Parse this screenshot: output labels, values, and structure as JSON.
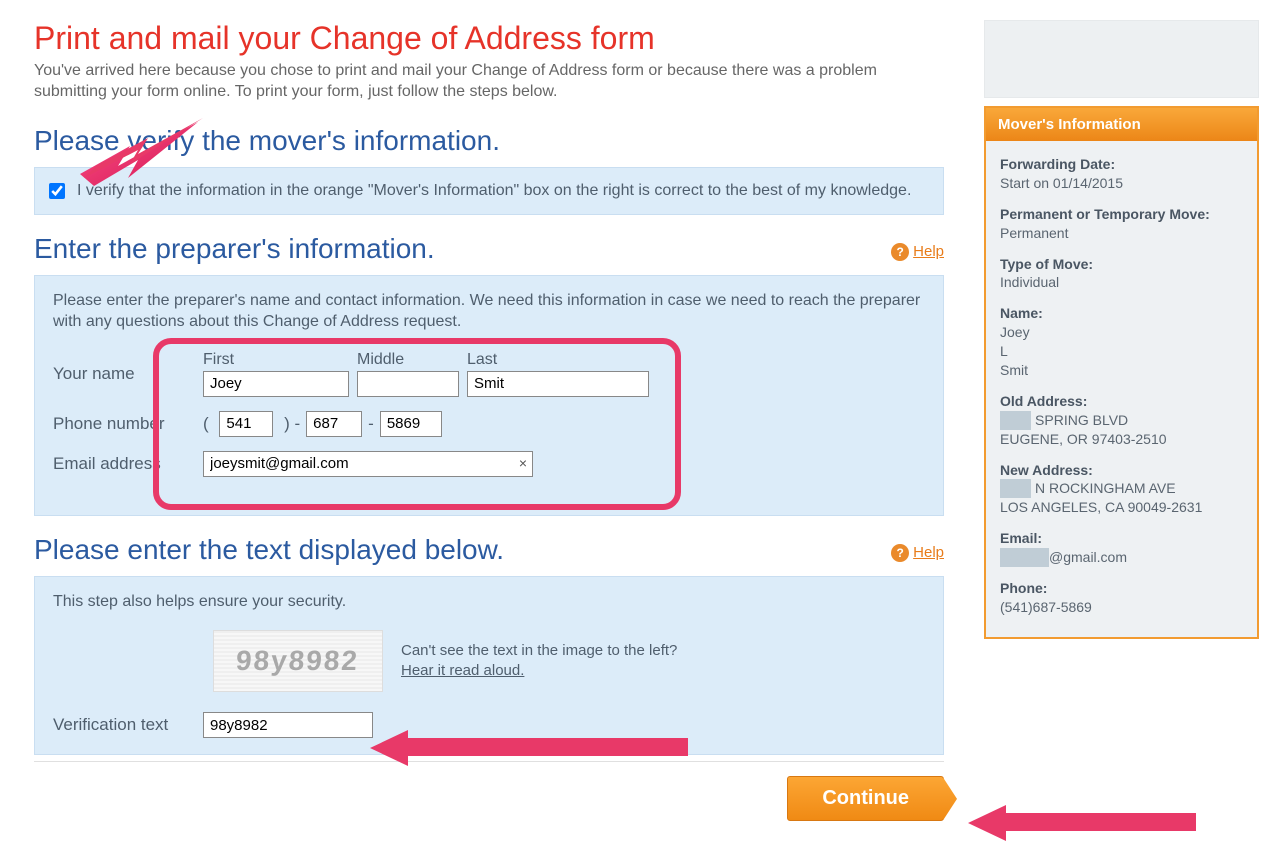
{
  "title": "Print and mail your Change of Address form",
  "intro": "You've arrived here because you chose to print and mail your Change of Address form or because there was a problem submitting your form online. To print your form, just follow the steps below.",
  "verify_heading": "Please verify the mover's information.",
  "verify_label": "I verify that the information in the orange \"Mover's Information\" box on the right is correct to the best of my knowledge.",
  "preparer_heading": "Enter the preparer's information.",
  "help_label": "Help",
  "preparer_note": "Please enter the preparer's name and contact information. We need this information in case we need to reach the preparer with any questions about this Change of Address request.",
  "name_label": "Your name",
  "first_hdr": "First",
  "middle_hdr": "Middle",
  "last_hdr": "Last",
  "first_val": "Joey",
  "middle_val": "",
  "last_val": "Smit",
  "phone_label": "Phone number",
  "phone_a": "541",
  "phone_b": "687",
  "phone_c": "5869",
  "email_label": "Email address",
  "email_val": "joeysmit@gmail.com",
  "captcha_heading": "Please enter the text displayed below.",
  "captcha_note": "This step also helps ensure your security.",
  "captcha_value_img": "98y8982",
  "captcha_cant_see": "Can't see the text in the image to the left?",
  "captcha_hear": "Hear it read aloud.",
  "verification_label": "Verification text",
  "verification_val": "98y8982",
  "continue_label": "Continue",
  "sidebar": {
    "header": "Mover's Information",
    "fwd_lbl": "Forwarding Date:",
    "fwd_val": "Start on 01/14/2015",
    "move_type_lbl": "Permanent or Temporary Move:",
    "move_type_val": "Permanent",
    "type_lbl": "Type of Move:",
    "type_val": "Individual",
    "name_lbl": "Name:",
    "name_first": "Joey",
    "name_mi": "L",
    "name_last": "Smit",
    "old_lbl": "Old Address:",
    "old_line1": " SPRING BLVD",
    "old_line2": "EUGENE, OR 97403-2510",
    "new_lbl": "New Address:",
    "new_line1": "N ROCKINGHAM AVE",
    "new_line2": "LOS ANGELES, CA 90049-2631",
    "email_lbl": "Email:",
    "email_val": "@gmail.com",
    "phone_lbl": "Phone:",
    "phone_val": "(541)687-5869"
  }
}
